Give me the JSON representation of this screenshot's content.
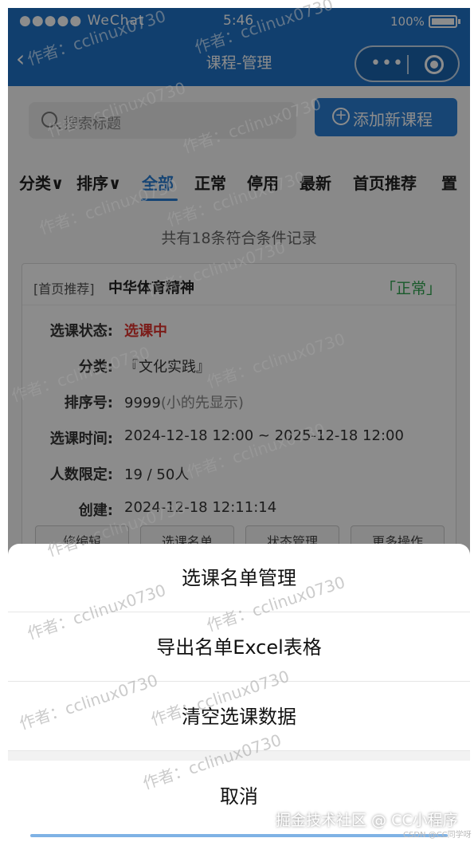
{
  "statusbar": {
    "carrier": "●●●●● WeChat",
    "wifi": "令",
    "time": "5:46",
    "battery": "100%"
  },
  "navbar": {
    "back_icon": "‹",
    "title": "课程-管理",
    "more_icon": "•••"
  },
  "search": {
    "placeholder": "搜索标题",
    "add_button": "添加新课程",
    "add_icon": "+"
  },
  "filters": {
    "category": "分类∨",
    "sort": "排序∨",
    "tabs": [
      "全部",
      "正常",
      "停用",
      "最新",
      "首页推荐",
      "置"
    ]
  },
  "list": {
    "count_text": "共有18条符合条件记录"
  },
  "course": {
    "tag": "[首页推荐]",
    "name": "中华体育精神",
    "status": "「正常」",
    "fields": [
      {
        "label": "选课状态:",
        "value": "选课中"
      },
      {
        "label": "分类:",
        "value": "『文化实践』"
      },
      {
        "label": "排序号:",
        "value": "9999",
        "note": "(小的先显示)"
      },
      {
        "label": "选课时间:",
        "value": "2024-12-18 12:00 ~ 2025-12-18 12:00"
      },
      {
        "label": "人数限定:",
        "value": "19 / 50人"
      },
      {
        "label": "创建:",
        "value": "2024-12-18 12:11:14"
      }
    ],
    "actions": [
      "修编辑",
      "选课名单",
      "状态管理",
      "更多操作"
    ]
  },
  "action_sheet": {
    "items": [
      "选课名单管理",
      "导出名单Excel表格",
      "清空选课数据"
    ],
    "cancel": "取消"
  },
  "watermark": "作者：cclinux0730",
  "footer": {
    "brand": "掘金技术社区 @ CC小程序",
    "csdn": "CSDN @CC同学呀"
  }
}
